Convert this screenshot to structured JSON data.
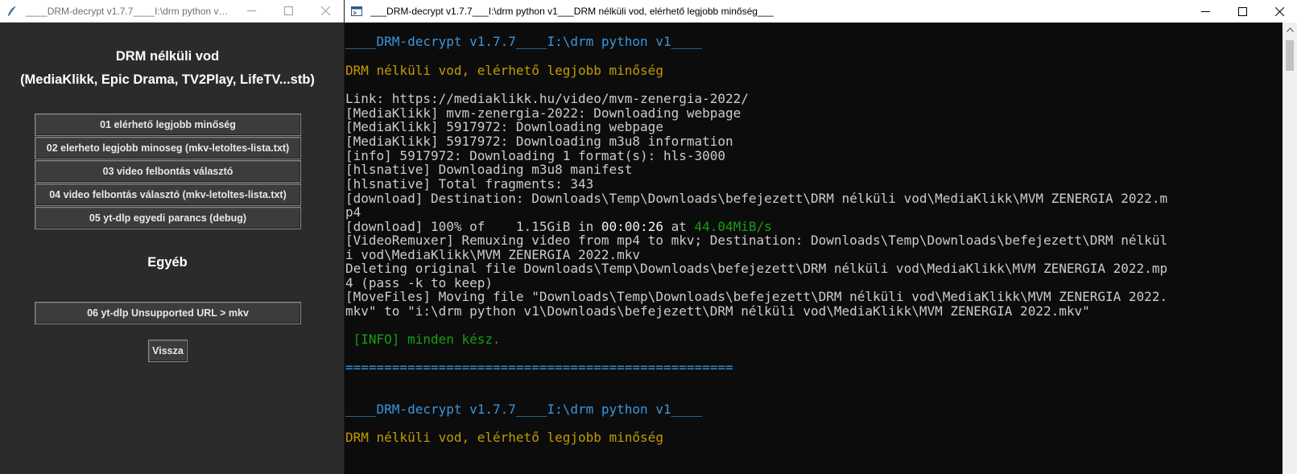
{
  "left_window": {
    "title": "____DRM-decrypt v1.7.7____I:\\drm python v1__...",
    "heading_line1": "DRM nélküli vod",
    "heading_line2": "(MediaKlikk, Epic Drama, TV2Play, LifeTV...stb)",
    "buttons": [
      "01 elérhető legjobb minőség",
      "02 elerheto legjobb minoseg (mkv-letoltes-lista.txt)",
      "03 video felbontás választó",
      "04 video felbontás választó (mkv-letoltes-lista.txt)",
      "05 yt-dlp egyedi parancs (debug)"
    ],
    "other_heading": "Egyéb",
    "other_button": "06 yt-dlp Unsupported URL > mkv",
    "back_button": "Vissza"
  },
  "right_window": {
    "title": "___DRM-decrypt v1.7.7___I:\\drm python v1___DRM nélküli vod, elérhető legjobb minőség___",
    "console": {
      "header": "____DRM-decrypt v1.7.7____I:\\drm python v1____",
      "subheader": "DRM nélküli vod, elérhető legjobb minőség",
      "lines": [
        "Link: https://mediaklikk.hu/video/mvm-zenergia-2022/",
        "[MediaKlikk] mvm-zenergia-2022: Downloading webpage",
        "[MediaKlikk] 5917972: Downloading webpage",
        "[MediaKlikk] 5917972: Downloading m3u8 information",
        "[info] 5917972: Downloading 1 format(s): hls-3000",
        "[hlsnative] Downloading m3u8 manifest",
        "[hlsnative] Total fragments: 343",
        "[download] Destination: Downloads\\Temp\\Downloads\\befejezett\\DRM nélküli vod\\MediaKlikk\\MVM ZENERGIA 2022.m",
        "p4"
      ],
      "progress_prefix": "[download] 100% of    1.15GiB in ",
      "progress_time": "00:00:26",
      "progress_at": " at ",
      "progress_speed": "44.04MiB/s",
      "lines2": [
        "[VideoRemuxer] Remuxing video from mp4 to mkv; Destination: Downloads\\Temp\\Downloads\\befejezett\\DRM nélkül",
        "i vod\\MediaKlikk\\MVM ZENERGIA 2022.mkv",
        "Deleting original file Downloads\\Temp\\Downloads\\befejezett\\DRM nélküli vod\\MediaKlikk\\MVM ZENERGIA 2022.mp",
        "4 (pass -k to keep)",
        "[MoveFiles] Moving file \"Downloads\\Temp\\Downloads\\befejezett\\DRM nélküli vod\\MediaKlikk\\MVM ZENERGIA 2022.",
        "mkv\" to \"i:\\drm python v1\\Downloads\\befejezett\\DRM nélküli vod\\MediaKlikk\\MVM ZENERGIA 2022.mkv\""
      ],
      "info_done": " [INFO] minden kész.",
      "separator": "==================================================",
      "header2": "____DRM-decrypt v1.7.7____I:\\drm python v1____",
      "subheader2": "DRM nélküli vod, elérhető legjobb minőség"
    }
  },
  "colors": {
    "console_bg": "#0c0c0c",
    "console_text": "#cccccc",
    "console_blue": "#3a96dd",
    "console_yellow": "#c19c00",
    "console_green": "#13a10e",
    "gui_bg": "#2b2b2b"
  }
}
